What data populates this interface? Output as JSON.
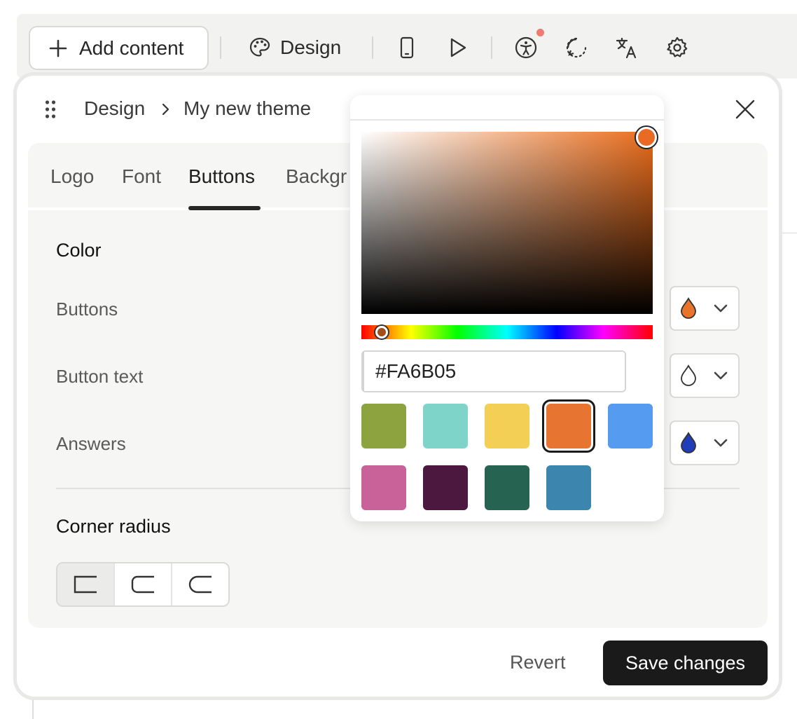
{
  "toolbar": {
    "add_content_label": "Add content",
    "design_label": "Design",
    "icons": [
      "plus-icon",
      "palette-icon",
      "mobile-preview-icon",
      "play-icon",
      "accessibility-icon",
      "loading-icon",
      "translate-icon",
      "gear-icon"
    ]
  },
  "breadcrumb": {
    "root": "Design",
    "current": "My new theme"
  },
  "tabs": [
    {
      "label": "Logo"
    },
    {
      "label": "Font"
    },
    {
      "label": "Buttons"
    },
    {
      "label": "Backgr"
    }
  ],
  "color_section": {
    "title": "Color",
    "rows": [
      {
        "label": "Buttons",
        "drop_color": "#E8742C"
      },
      {
        "label": "Button text",
        "drop_color": "#FFFFFF"
      },
      {
        "label": "Answers",
        "drop_color": "#1F3DB8"
      }
    ]
  },
  "corner_section": {
    "title": "Corner radius",
    "options": [
      "square",
      "rounded",
      "round"
    ],
    "selected": "square"
  },
  "footer": {
    "revert_label": "Revert",
    "save_label": "Save changes"
  },
  "picker": {
    "hex_value": "#FA6B05",
    "preview_color": "#E87431",
    "swatches": [
      {
        "color": "#8DA33F",
        "selected": false
      },
      {
        "color": "#7ED4C9",
        "selected": false
      },
      {
        "color": "#F4CF55",
        "selected": false
      },
      {
        "color": "#E87431",
        "selected": true
      },
      {
        "color": "#559BF0",
        "selected": false
      },
      {
        "color": "#C86298",
        "selected": false
      },
      {
        "color": "#4C1840",
        "selected": false
      },
      {
        "color": "#266351",
        "selected": false
      },
      {
        "color": "#3B85AE",
        "selected": false
      }
    ]
  }
}
